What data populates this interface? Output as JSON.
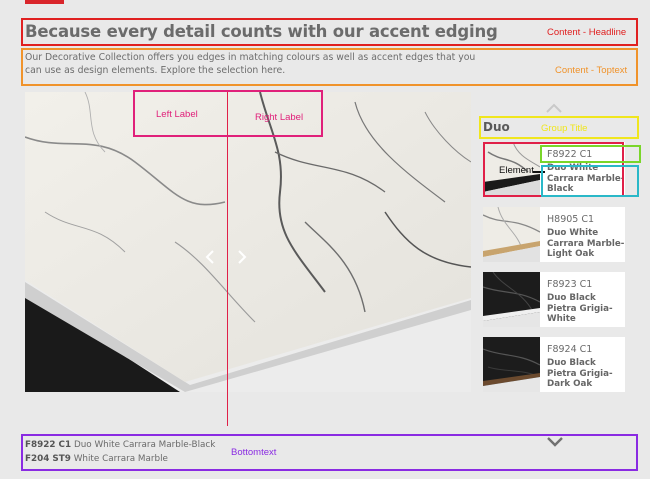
{
  "colors": {
    "brand_red": "#d9252b",
    "annot_red": "#e02020",
    "annot_orange": "#f0932b",
    "annot_pink": "#e0207a",
    "annot_yellow": "#f0e61e",
    "annot_green": "#7ad62a",
    "annot_cyan": "#2ab8c8",
    "annot_purple": "#8a2be2"
  },
  "content": {
    "headline": "Because every detail counts with our accent edging",
    "toptext": "Our Decorative Collection offers you edges in matching colours as well as accent edges that you can use as design elements. Explore the selection here."
  },
  "annotations": {
    "headline": "Content - Headline",
    "toptext": "Content - Toptext",
    "left_label": "Left Label",
    "right_label": "Right Label",
    "group_title": "Group Title",
    "element": "Element",
    "bottomtext": "Bottomtext"
  },
  "viewer": {
    "prev_icon": "chevron-left-icon",
    "next_icon": "chevron-right-icon"
  },
  "sidebar": {
    "group_title": "Duo",
    "scroll_up_icon": "chevron-up-icon",
    "scroll_down_icon": "chevron-down-icon",
    "items": [
      {
        "code": "F8922 C1",
        "name": "Duo White Carrara Marble-Black",
        "swatch": "white-marble-black-edge"
      },
      {
        "code": "H8905 C1",
        "name": "Duo White Carrara Marble-Light Oak",
        "swatch": "white-marble-oak-edge"
      },
      {
        "code": "F8923 C1",
        "name": "Duo Black Pietra Grigia-White",
        "swatch": "black-stone-white-edge"
      },
      {
        "code": "F8924 C1",
        "name": "Duo Black Pietra Grigia-Dark Oak",
        "swatch": "black-stone-dark-oak-edge"
      }
    ]
  },
  "bottom": {
    "line1_code": "F8922 C1",
    "line1_name": "Duo White Carrara Marble-Black",
    "line2_code": "F204 ST9",
    "line2_name": "White Carrara Marble"
  }
}
